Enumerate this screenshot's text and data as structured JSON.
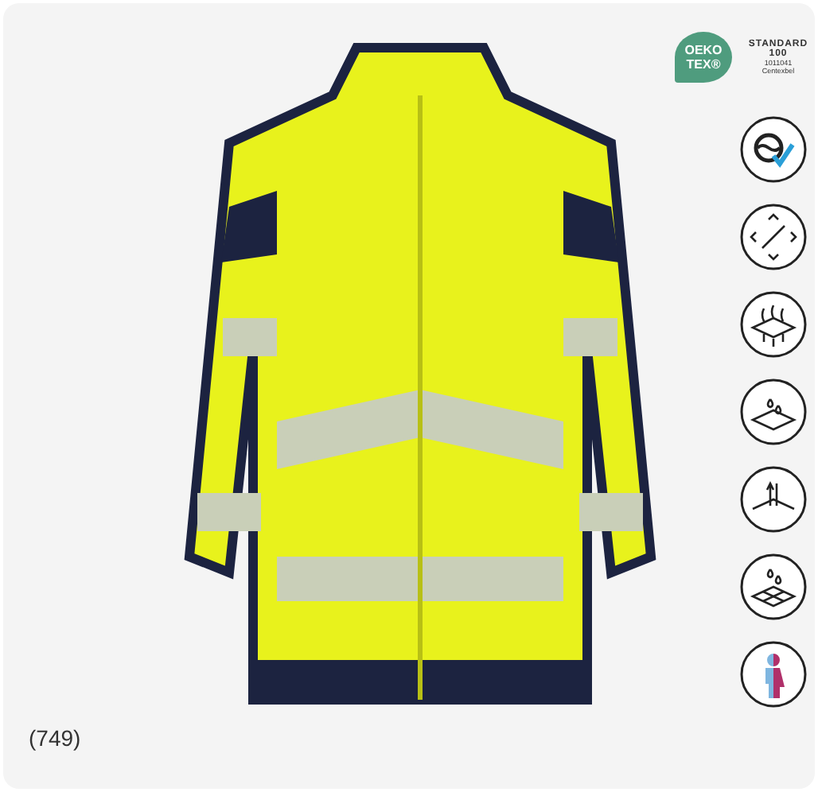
{
  "certification_logo": {
    "mark": "OEKO TEX®",
    "standard": "STANDARD 100",
    "number": "1011041",
    "institute": "Centexbel"
  },
  "review_count": "(749)"
}
